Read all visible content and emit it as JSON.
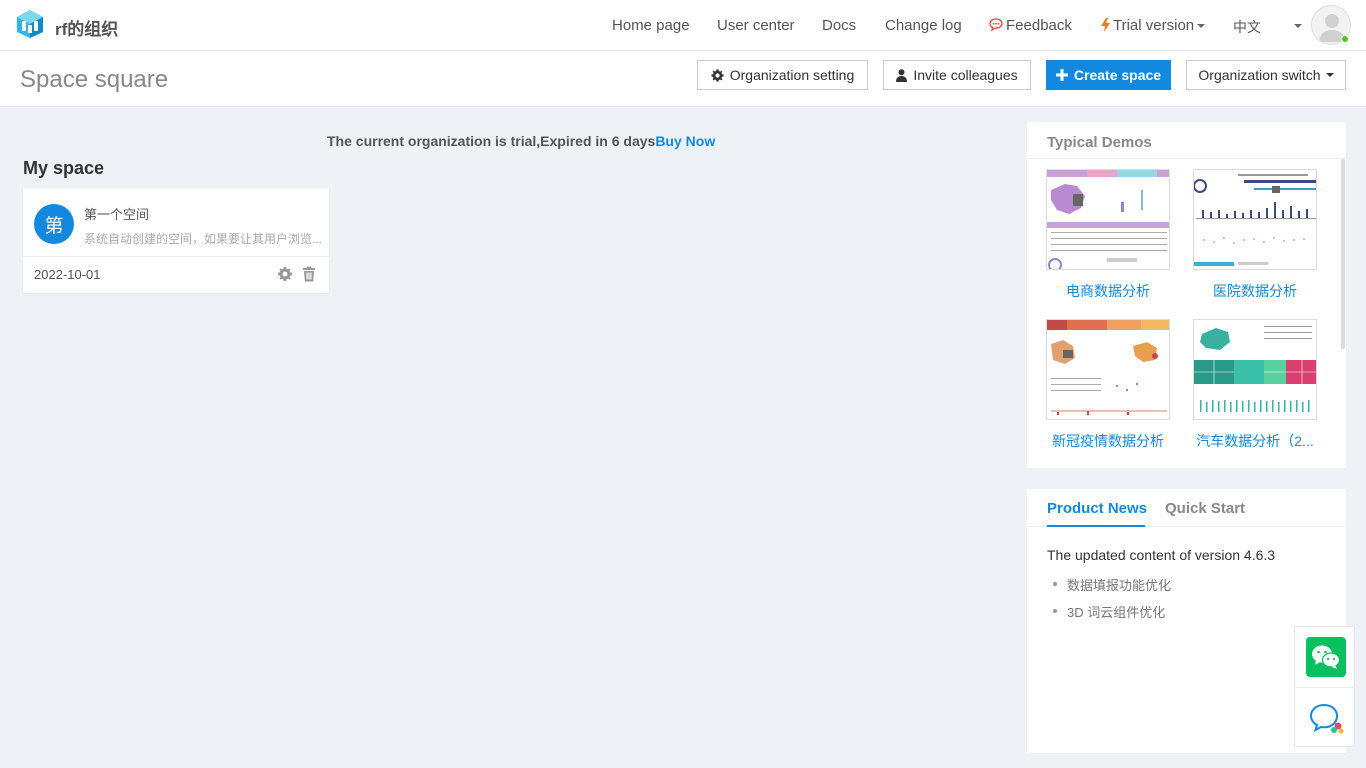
{
  "org": {
    "name": "rf的组织"
  },
  "nav": {
    "home": "Home page",
    "user_center": "User center",
    "docs": "Docs",
    "change_log": "Change log",
    "feedback": "Feedback",
    "trial_version": "Trial version",
    "language": "中文"
  },
  "header": {
    "title": "Space square",
    "org_setting": "Organization setting",
    "invite": "Invite colleagues",
    "create_space": "Create space",
    "org_switch": "Organization switch"
  },
  "trial": {
    "message": "The current organization is trial,Expired in 6 days",
    "buy_now": "Buy Now"
  },
  "my_space": {
    "title": "My space",
    "spaces": [
      {
        "icon_char": "第",
        "name": "第一个空间",
        "description": "系统自动创建的空间，如果要让其用户浏览...",
        "date": "2022-10-01"
      }
    ]
  },
  "demos": {
    "title": "Typical Demos",
    "items": [
      {
        "label": "电商数据分析"
      },
      {
        "label": "医院数据分析"
      },
      {
        "label": "新冠疫情数据分析"
      },
      {
        "label": "汽车数据分析（2..."
      }
    ]
  },
  "news": {
    "tabs": [
      "Product News",
      "Quick Start"
    ],
    "active_tab": "Product News",
    "version_title": "The updated content of version 4.6.3",
    "items": [
      "数据填报功能优化",
      "3D 词云组件优化"
    ]
  },
  "colors": {
    "accent": "#1289de",
    "background": "#eef1f6",
    "wechat_green": "#07c160",
    "online": "#52c41a"
  },
  "icons": [
    "logo-icon",
    "feedback-icon",
    "lightning-icon",
    "gear-icon",
    "user-icon",
    "plus-icon",
    "trash-icon",
    "wechat-icon",
    "chat-support-icon"
  ]
}
